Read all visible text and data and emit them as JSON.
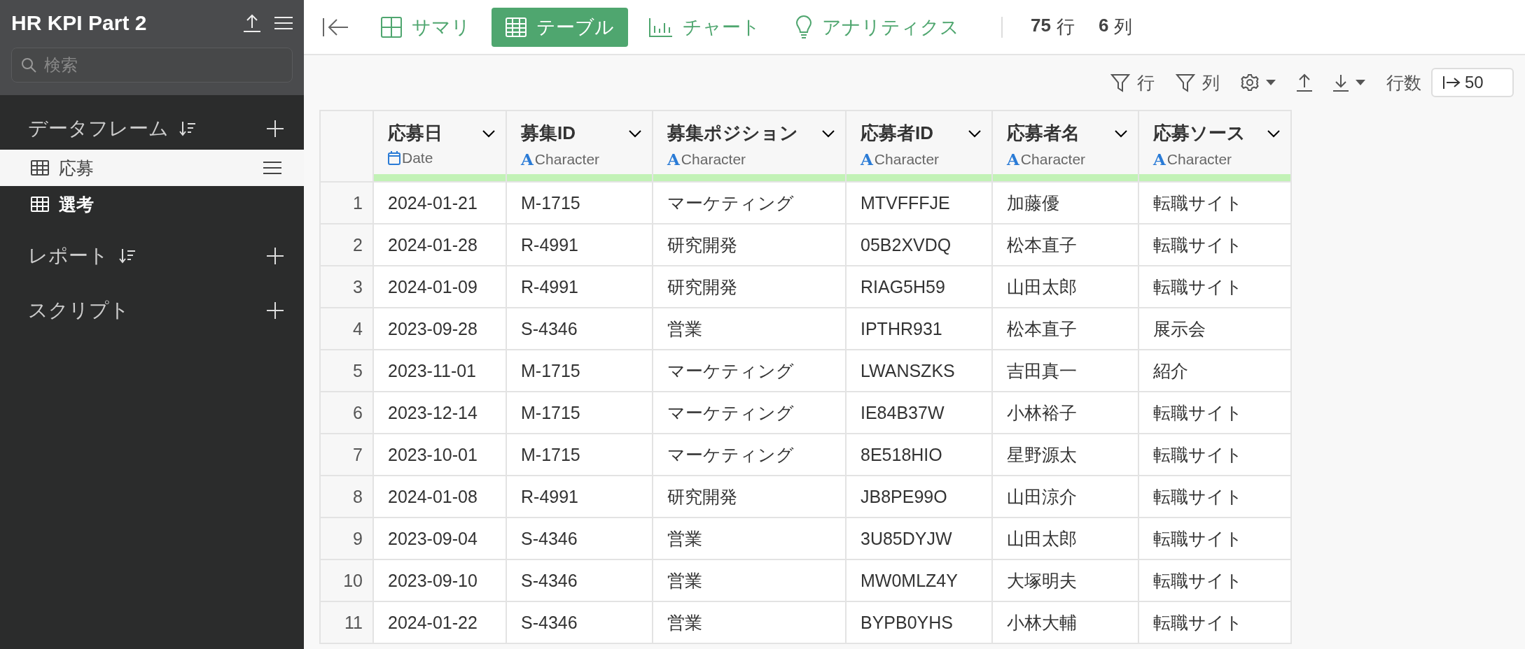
{
  "project": {
    "title": "HR KPI Part 2"
  },
  "search": {
    "placeholder": "検索"
  },
  "sections": [
    {
      "title": "データフレーム",
      "sortable": true,
      "items": [
        {
          "label": "応募",
          "selected": true
        },
        {
          "label": "選考",
          "selected": false
        }
      ]
    },
    {
      "title": "レポート",
      "sortable": true
    },
    {
      "title": "スクリプト",
      "sortable": false
    }
  ],
  "view_tabs": [
    {
      "kind": "summary",
      "label": "サマリ",
      "selected": false
    },
    {
      "kind": "table",
      "label": "テーブル",
      "selected": true
    },
    {
      "kind": "chart",
      "label": "チャート",
      "selected": false
    },
    {
      "kind": "analytics",
      "label": "アナリティクス",
      "selected": false
    }
  ],
  "counts": [
    {
      "value": "75",
      "unit": "行"
    },
    {
      "value": "6",
      "unit": "列"
    }
  ],
  "toolbar": {
    "row_filter": "行",
    "column_filter": "列",
    "rows_label": "行数",
    "rows_value": "50"
  },
  "table": {
    "columns": [
      {
        "name": "応募日",
        "kind": "date",
        "type_label": "Date"
      },
      {
        "name": "募集ID",
        "kind": "character",
        "type_icon": "A",
        "type_label": "Character"
      },
      {
        "name": "募集ポジション",
        "kind": "character",
        "type_icon": "A",
        "type_label": "Character"
      },
      {
        "name": "応募者ID",
        "kind": "character",
        "type_icon": "A",
        "type_label": "Character"
      },
      {
        "name": "応募者名",
        "kind": "character",
        "type_icon": "A",
        "type_label": "Character"
      },
      {
        "name": "応募ソース",
        "kind": "character",
        "type_icon": "A",
        "type_label": "Character"
      }
    ],
    "rows": [
      {
        "index": "1",
        "cells": [
          "2024-01-21",
          "M-1715",
          "マーケティング",
          "MTVFFFJE",
          "加藤優",
          "転職サイト"
        ]
      },
      {
        "index": "2",
        "cells": [
          "2024-01-28",
          "R-4991",
          "研究開発",
          "05B2XVDQ",
          "松本直子",
          "転職サイト"
        ]
      },
      {
        "index": "3",
        "cells": [
          "2024-01-09",
          "R-4991",
          "研究開発",
          "RIAG5H59",
          "山田太郎",
          "転職サイト"
        ]
      },
      {
        "index": "4",
        "cells": [
          "2023-09-28",
          "S-4346",
          "営業",
          "IPTHR931",
          "松本直子",
          "展示会"
        ]
      },
      {
        "index": "5",
        "cells": [
          "2023-11-01",
          "M-1715",
          "マーケティング",
          "LWANSZKS",
          "吉田真一",
          "紹介"
        ]
      },
      {
        "index": "6",
        "cells": [
          "2023-12-14",
          "M-1715",
          "マーケティング",
          "IE84B37W",
          "小林裕子",
          "転職サイト"
        ]
      },
      {
        "index": "7",
        "cells": [
          "2023-10-01",
          "M-1715",
          "マーケティング",
          "8E518HIO",
          "星野源太",
          "転職サイト"
        ]
      },
      {
        "index": "8",
        "cells": [
          "2024-01-08",
          "R-4991",
          "研究開発",
          "JB8PE99O",
          "山田涼介",
          "転職サイト"
        ]
      },
      {
        "index": "9",
        "cells": [
          "2023-09-04",
          "S-4346",
          "営業",
          "3U85DYJW",
          "山田太郎",
          "転職サイト"
        ]
      },
      {
        "index": "10",
        "cells": [
          "2023-09-10",
          "S-4346",
          "営業",
          "MW0MLZ4Y",
          "大塚明夫",
          "転職サイト"
        ]
      },
      {
        "index": "11",
        "cells": [
          "2024-01-22",
          "S-4346",
          "営業",
          "BYPB0YHS",
          "小林大輔",
          "転職サイト"
        ]
      }
    ]
  }
}
